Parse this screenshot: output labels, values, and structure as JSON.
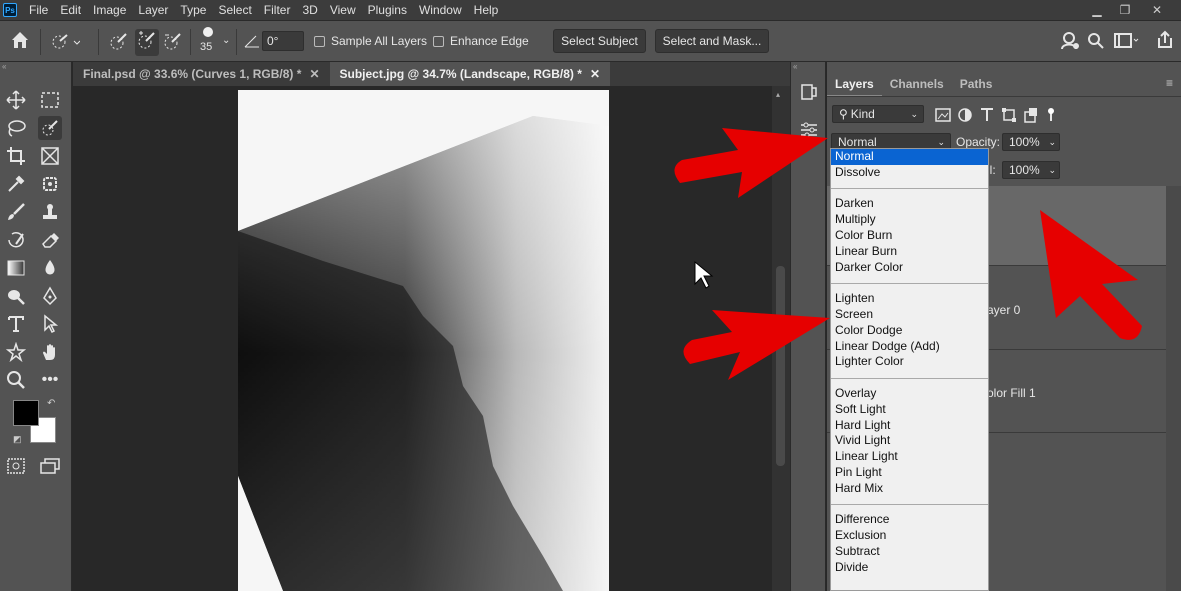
{
  "menubar": {
    "logo": "Ps",
    "items": [
      "File",
      "Edit",
      "Image",
      "Layer",
      "Type",
      "Select",
      "Filter",
      "3D",
      "View",
      "Plugins",
      "Window",
      "Help"
    ]
  },
  "options": {
    "brush_size": "35",
    "angle_value": "0°",
    "sample_all_layers": "Sample All Layers",
    "enhance_edge": "Enhance Edge",
    "select_subject": "Select Subject",
    "select_and_mask": "Select and Mask..."
  },
  "tabs": [
    {
      "label": "Final.psd @ 33.6% (Curves 1, RGB/8) *",
      "active": false
    },
    {
      "label": "Subject.jpg @ 34.7% (Landscape, RGB/8) *",
      "active": true
    }
  ],
  "panel": {
    "tabs": [
      "Layers",
      "Channels",
      "Paths"
    ],
    "kind_label": "Kind",
    "blend_mode": "Normal",
    "opacity_label": "Opacity:",
    "opacity_value": "100%",
    "fill_label": "ll:",
    "fill_value": "100%",
    "layers": [
      "ayer 0",
      "olor Fill 1"
    ]
  },
  "blend_dropdown": {
    "groups": [
      [
        "Normal",
        "Dissolve"
      ],
      [
        "Darken",
        "Multiply",
        "Color Burn",
        "Linear Burn",
        "Darker Color"
      ],
      [
        "Lighten",
        "Screen",
        "Color Dodge",
        "Linear Dodge (Add)",
        "Lighter Color"
      ],
      [
        "Overlay",
        "Soft Light",
        "Hard Light",
        "Vivid Light",
        "Linear Light",
        "Pin Light",
        "Hard Mix"
      ],
      [
        "Difference",
        "Exclusion",
        "Subtract",
        "Divide"
      ]
    ],
    "selected": "Normal"
  },
  "colors": {
    "accent_selection": "#0a64d2",
    "annotation_arrow": "#e60000",
    "foreground_swatch": "#000000",
    "background_swatch": "#ffffff"
  }
}
